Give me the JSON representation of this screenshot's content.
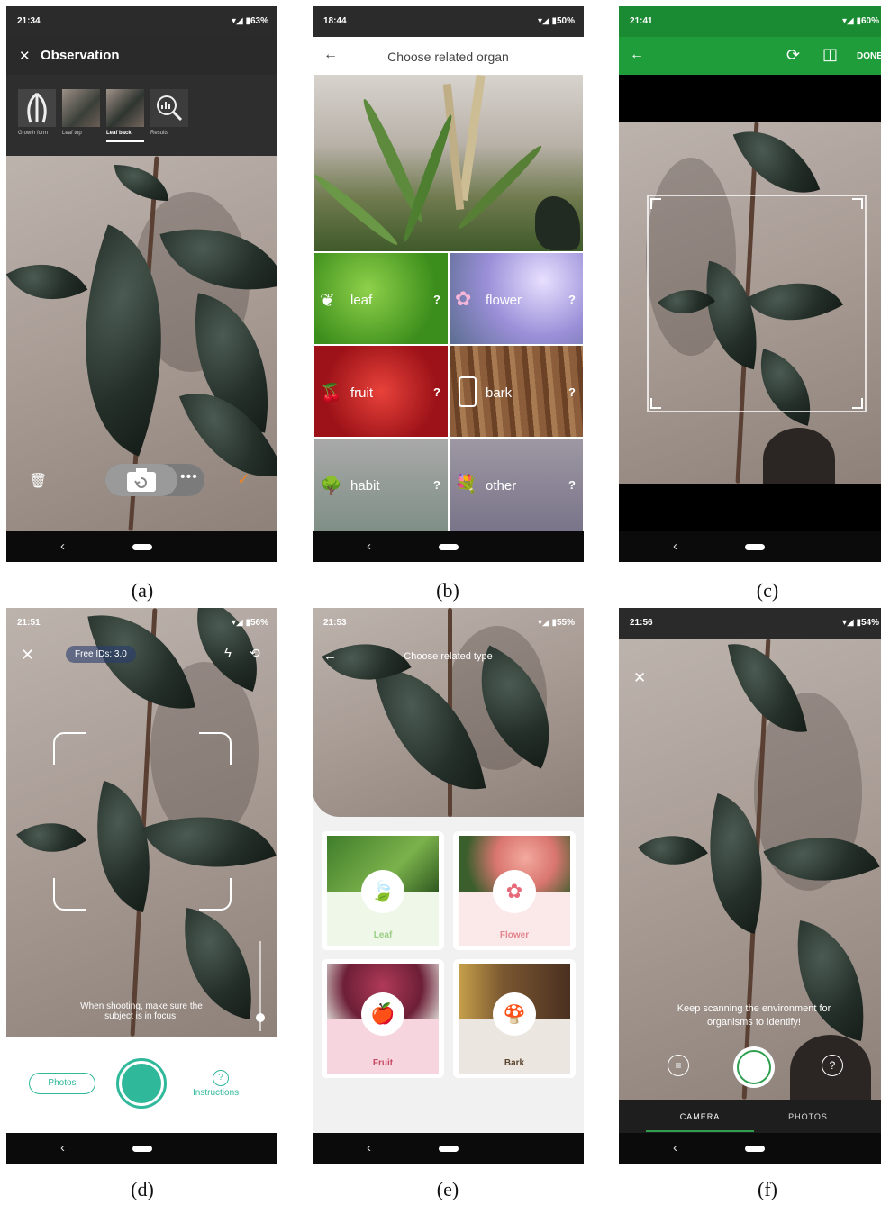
{
  "captions": [
    "(a)",
    "(b)",
    "(c)",
    "(d)",
    "(e)",
    "(f)"
  ],
  "a": {
    "time": "21:34",
    "battery": "63%",
    "title": "Observation",
    "tabs": [
      "Growth form",
      "Leaf top",
      "Leaf back",
      "Results"
    ],
    "active_tab": "Leaf back",
    "colors": {
      "accent": "#e8842a",
      "topbar": "#2a2a2a"
    }
  },
  "b": {
    "time": "18:44",
    "battery": "50%",
    "title": "Choose related organ",
    "organs": [
      {
        "label": "leaf",
        "help": "?"
      },
      {
        "label": "flower",
        "help": "?"
      },
      {
        "label": "fruit",
        "help": "?"
      },
      {
        "label": "bark",
        "help": "?"
      },
      {
        "label": "habit",
        "help": "?"
      },
      {
        "label": "other",
        "help": "?"
      }
    ]
  },
  "c": {
    "time": "21:41",
    "battery": "60%",
    "done_label": "DONE",
    "colors": {
      "toolbar": "#1f9d3a"
    }
  },
  "d": {
    "time": "21:51",
    "battery": "56%",
    "free_ids": "Free IDs: 3.0",
    "hint": "When shooting, make sure the subject is in focus.",
    "photos_label": "Photos",
    "instructions_label": "Instructions",
    "colors": {
      "accent": "#2fb89a"
    }
  },
  "e": {
    "time": "21:53",
    "battery": "55%",
    "title": "Choose related type",
    "types": [
      "Leaf",
      "Flower",
      "Fruit",
      "Bark"
    ]
  },
  "f": {
    "time": "21:56",
    "battery": "54%",
    "hint": "Keep scanning the environment for organisms to identify!",
    "tabs": [
      "CAMERA",
      "PHOTOS"
    ],
    "active_tab": "CAMERA",
    "colors": {
      "accent": "#2f9f4f"
    }
  }
}
